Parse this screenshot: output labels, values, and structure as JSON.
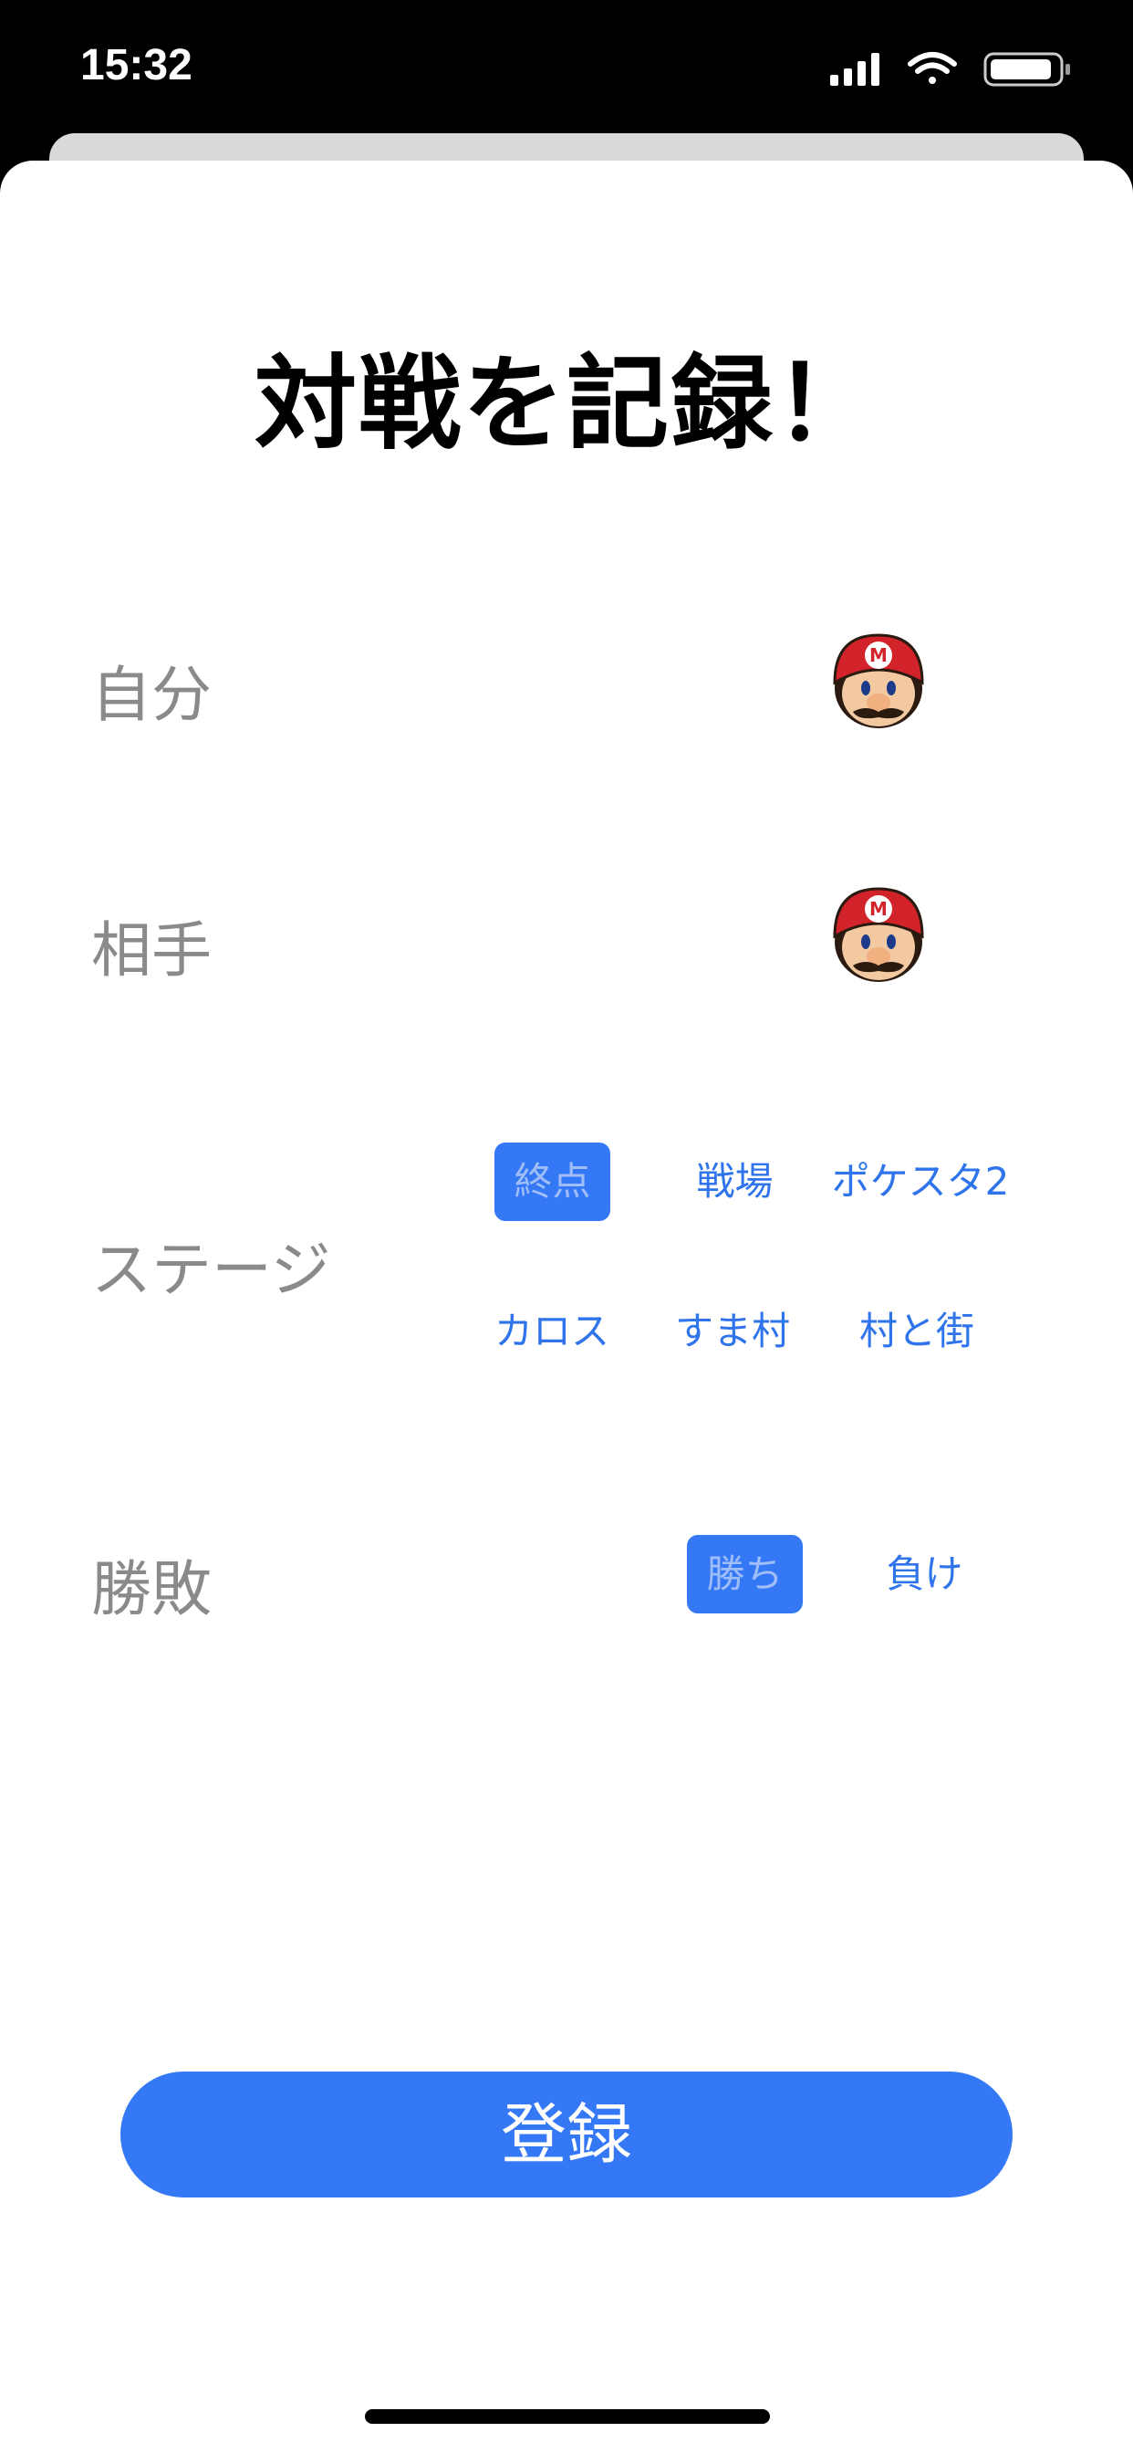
{
  "status_bar": {
    "time": "15:32",
    "icons": [
      "signal-icon",
      "wifi-icon",
      "battery-icon"
    ]
  },
  "page": {
    "title": "対戦を記録！"
  },
  "form": {
    "self": {
      "label": "自分",
      "character_icon": "mario-icon"
    },
    "opponent": {
      "label": "相手",
      "character_icon": "mario-icon"
    },
    "stage": {
      "label": "ステージ",
      "options": [
        "終点",
        "戦場",
        "ポケスタ2",
        "カロス",
        "すま村",
        "村と街"
      ],
      "selected": "終点"
    },
    "result": {
      "label": "勝敗",
      "options": [
        "勝ち",
        "負け"
      ],
      "selected": "勝ち"
    }
  },
  "submit": {
    "label": "登録"
  },
  "colors": {
    "accent": "#3478f6",
    "label_gray": "#8a8a8a",
    "mario_red": "#d3232a"
  }
}
